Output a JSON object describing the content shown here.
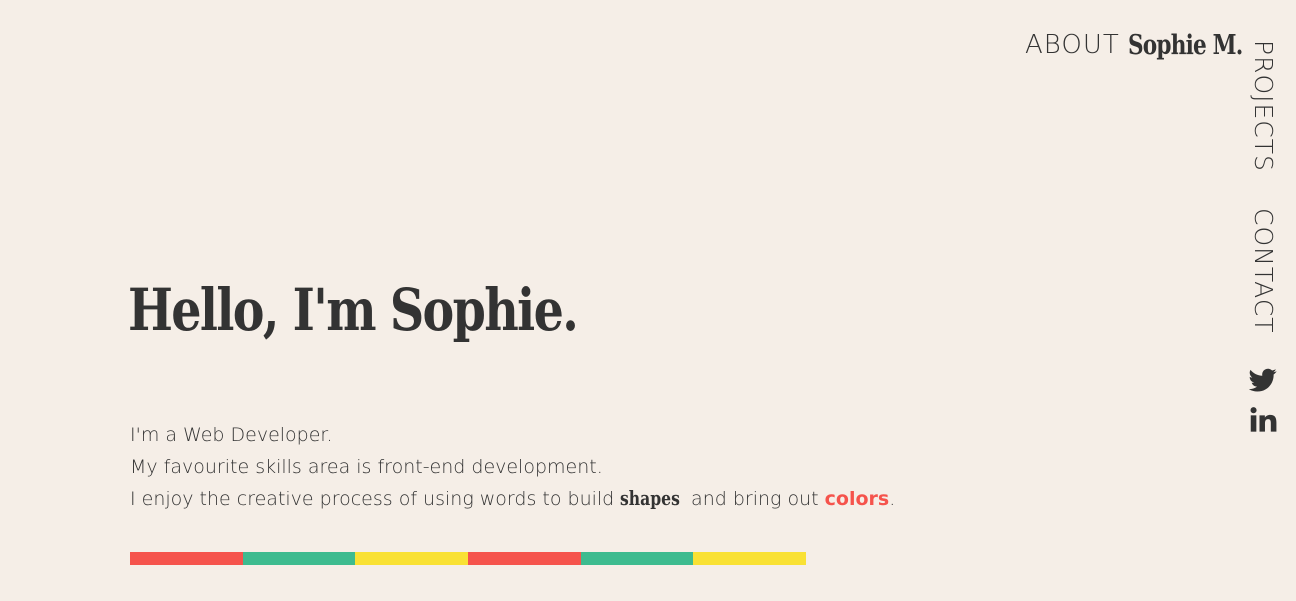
{
  "nav": {
    "about": "ABOUT",
    "brand": "Sophie M.",
    "projects": "PROJECTS",
    "contact": "CONTACT",
    "social": [
      {
        "icon": "twitter-icon"
      },
      {
        "icon": "linkedin-icon"
      }
    ]
  },
  "hero": {
    "title": "Hello, I'm Sophie.",
    "line1": "I'm a Web Developer.",
    "line2": "My favourite skills area is front-end development.",
    "line3_before": "I enjoy the creative process of using words to build ",
    "line3_shapes": "shapes",
    "line3_middle": " and bring out ",
    "line3_colors": "colors",
    "line3_end": "."
  },
  "colors": {
    "background": "#f5eee7",
    "text": "#333333",
    "red": "#f5534c",
    "green": "#3dbb8f",
    "yellow": "#f9e134"
  },
  "strip": [
    "#f5534c",
    "#3dbb8f",
    "#f9e134",
    "#f5534c",
    "#3dbb8f",
    "#f9e134"
  ]
}
